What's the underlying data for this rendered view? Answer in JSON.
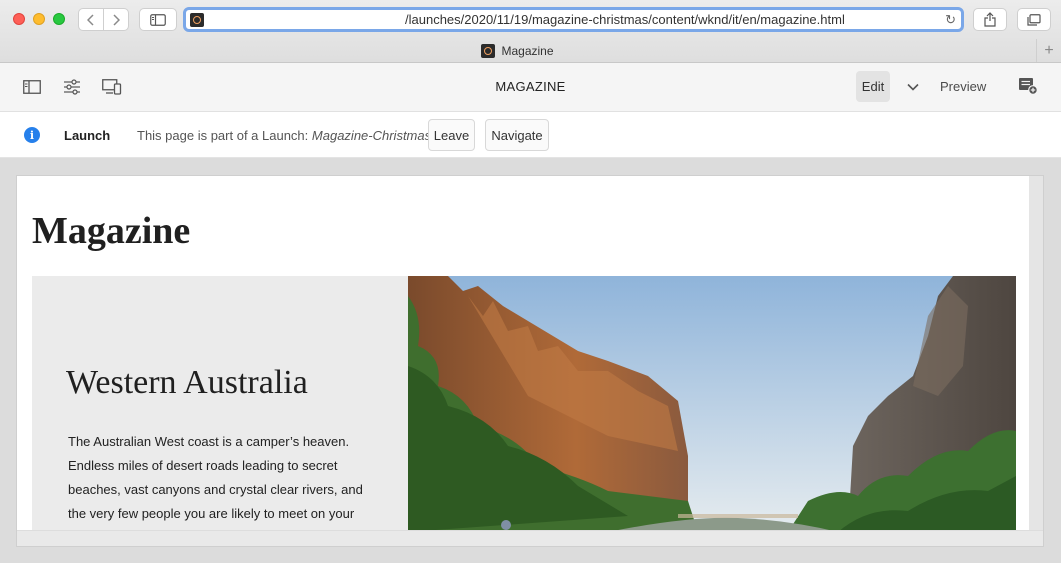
{
  "browser": {
    "url": "/launches/2020/11/19/magazine-christmas/content/wknd/it/en/magazine.html",
    "tab_title": "Magazine",
    "new_tab_symbol": "+"
  },
  "toolbar": {
    "title": "MAGAZINE",
    "edit_label": "Edit",
    "preview_label": "Preview",
    "icons": [
      "side-panel-icon",
      "page-properties-icon",
      "emulator-icon",
      "chevron-down-icon",
      "annotations-icon"
    ]
  },
  "launch_bar": {
    "label": "Launch",
    "message_prefix": "This page is part of a Launch:",
    "launch_name": "Magazine-Christmas",
    "leave_label": "Leave",
    "navigate_label": "Navigate"
  },
  "page": {
    "title": "Magazine",
    "teaser": {
      "title": "Western Australia",
      "description": "The Australian West coast is a camper’s heaven. Endless miles of desert roads leading to secret beaches, vast canyons and crystal clear rivers, and the very few people you are likely to meet on your"
    }
  },
  "colors": {
    "accent_blue": "#2680eb",
    "url_focus": "#7aa7e8",
    "teaser_bg": "#ebebeb"
  }
}
